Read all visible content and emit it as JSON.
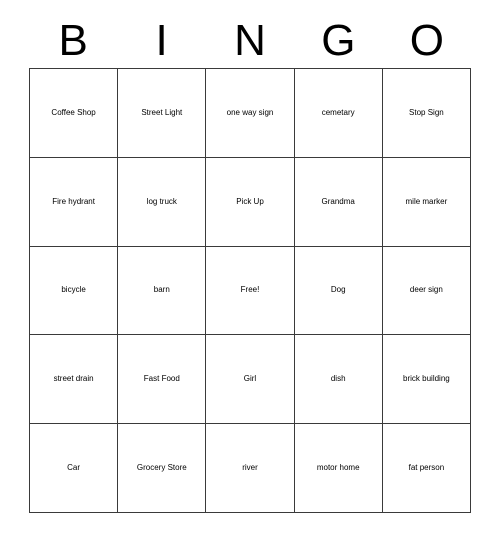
{
  "card": {
    "title": "BINGO",
    "header_letters": [
      "B",
      "I",
      "N",
      "G",
      "O"
    ],
    "columns": 5,
    "rows": 5,
    "border_color": "#3a3a3a",
    "background_color": "#ffffff",
    "text_color": "#000000",
    "free_space": "Free!",
    "cells": [
      [
        {
          "text": "Coffee Shop",
          "size": "sm"
        },
        {
          "text": "Street Light",
          "size": "lg"
        },
        {
          "text": "one way sign",
          "size": "sm"
        },
        {
          "text": "cemetary",
          "size": "xxs"
        },
        {
          "text": "Stop Sign",
          "size": "xl"
        }
      ],
      [
        {
          "text": "Fire hydrant",
          "size": "xs"
        },
        {
          "text": "log truck",
          "size": "xl"
        },
        {
          "text": "Pick Up",
          "size": "xl"
        },
        {
          "text": "Grandma",
          "size": "xxs"
        },
        {
          "text": "mile marker",
          "size": "md"
        }
      ],
      [
        {
          "text": "bicycle",
          "size": "md"
        },
        {
          "text": "barn",
          "size": "xl"
        },
        {
          "text": "Free!",
          "size": "xl"
        },
        {
          "text": "Dog",
          "size": "xl"
        },
        {
          "text": "deer sign",
          "size": "xl"
        }
      ],
      [
        {
          "text": "street drain",
          "size": "md"
        },
        {
          "text": "Fast Food",
          "size": "lg"
        },
        {
          "text": "Girl",
          "size": "xl"
        },
        {
          "text": "dish",
          "size": "xl"
        },
        {
          "text": "brick building",
          "size": "xs"
        }
      ],
      [
        {
          "text": "Car",
          "size": "xl"
        },
        {
          "text": "Grocery Store",
          "size": "xs"
        },
        {
          "text": "river",
          "size": "xl"
        },
        {
          "text": "motor home",
          "size": "lg"
        },
        {
          "text": "fat person",
          "size": "md"
        }
      ]
    ]
  }
}
